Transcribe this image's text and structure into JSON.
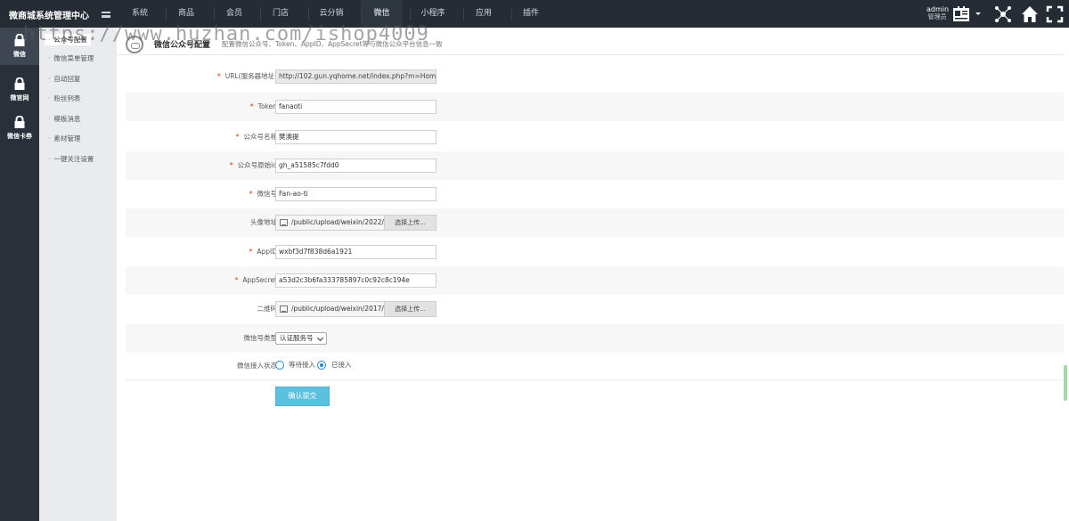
{
  "app": {
    "title": "微商城系统管理中心"
  },
  "topnav": [
    {
      "label": "系统"
    },
    {
      "label": "商品"
    },
    {
      "label": "会员"
    },
    {
      "label": "门店"
    },
    {
      "label": "云分销"
    },
    {
      "label": "微信",
      "active": true
    },
    {
      "label": "小程序"
    },
    {
      "label": "应用"
    },
    {
      "label": "插件"
    }
  ],
  "user": {
    "name": "admin",
    "role": "管理员"
  },
  "header_icons": [
    "id-card-icon",
    "network-icon",
    "home-icon",
    "expand-icon"
  ],
  "leftnav": [
    {
      "label": "微信",
      "icon": "lock-icon",
      "active": true
    },
    {
      "label": "微官网",
      "icon": "lock-icon"
    },
    {
      "label": "微信卡券",
      "icon": "lock-icon"
    }
  ],
  "subnav": [
    {
      "label": "公众号配置",
      "active": true
    },
    {
      "label": "微信菜单管理"
    },
    {
      "label": "自动回复"
    },
    {
      "label": "粉丝列表"
    },
    {
      "label": "模板消息"
    },
    {
      "label": "素材管理"
    },
    {
      "label": "一键关注设置"
    }
  ],
  "page": {
    "title": "微信公众号配置",
    "desc": "配置微信公众号、Token、AppID、AppSecret等与微信公众平台信息一致"
  },
  "form": {
    "url": {
      "label": "URL(服务器地址)",
      "value": "http://102.gun.yqhome.net/index.php?m=Home&c=Weixin"
    },
    "token": {
      "label": "Token",
      "value": "fanaoti"
    },
    "name": {
      "label": "公众号名称",
      "value": "樊澳提"
    },
    "origin_id": {
      "label": "公众号原始id",
      "value": "gh_a51585c7fdd0"
    },
    "wechat_id": {
      "label": "微信号",
      "value": "Fan-ao-ti"
    },
    "avatar": {
      "label": "头像地址",
      "value": "/public/upload/weixin/2022/",
      "button": "选择上传..."
    },
    "appid": {
      "label": "AppID",
      "value": "wxbf3d7f838d6a1921"
    },
    "appsecret": {
      "label": "AppSecret",
      "value": "a53d2c3b6fa333785897c0c92c8c194e"
    },
    "qrcode": {
      "label": "二维码",
      "value": "/public/upload/weixin/2017/",
      "button": "选择上传..."
    },
    "type": {
      "label": "微信号类型",
      "selected": "认证服务号"
    },
    "access": {
      "label": "微信接入状态",
      "options": [
        "等待接入",
        "已接入"
      ],
      "selected": "已接入"
    },
    "submit": "确认提交"
  },
  "watermark": "https://www.huzhan.com/ishop4009",
  "colors": {
    "topbar": "#252c34",
    "leftnav": "#2a3039",
    "subnav": "#e9ebee",
    "required": "#e36a3e",
    "submit": "#5bc0de",
    "radio": "#1e89d6"
  }
}
